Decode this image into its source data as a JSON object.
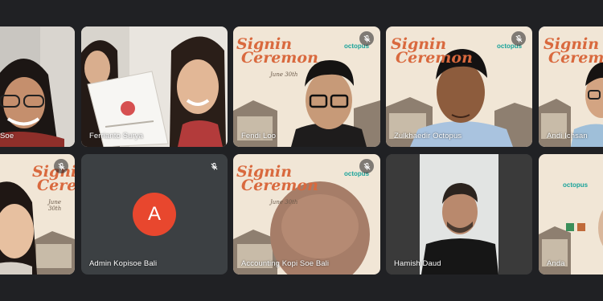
{
  "participants": [
    {
      "name": "Soe",
      "muted": false
    },
    {
      "name": "Ferrianto Surya",
      "muted": false
    },
    {
      "name": "Fendi Loo",
      "muted": true
    },
    {
      "name": "Zulkhaedir Octopus",
      "muted": true
    },
    {
      "name": "Andi Ichsan",
      "muted": false,
      "speaking": true
    },
    {
      "name": "",
      "muted": true
    },
    {
      "name": "Admin Kopisoe Bali",
      "muted": true,
      "avatar_letter": "A"
    },
    {
      "name": "Accounting Kopi Soe Bali",
      "muted": true
    },
    {
      "name": "Hamish Daud",
      "muted": false
    },
    {
      "name": "Anda",
      "muted": false
    }
  ],
  "poster": {
    "line1": "Signin",
    "line2": "Ceremon",
    "date": "June 30th",
    "brand": "octopus"
  },
  "colors": {
    "background": "#202124",
    "tile": "#3c4043",
    "avatar": "#e8472e",
    "speaking_outline": "#8ab4f8",
    "brand": "#1aa39a"
  },
  "icons": {
    "muted": "mic-off-icon"
  }
}
